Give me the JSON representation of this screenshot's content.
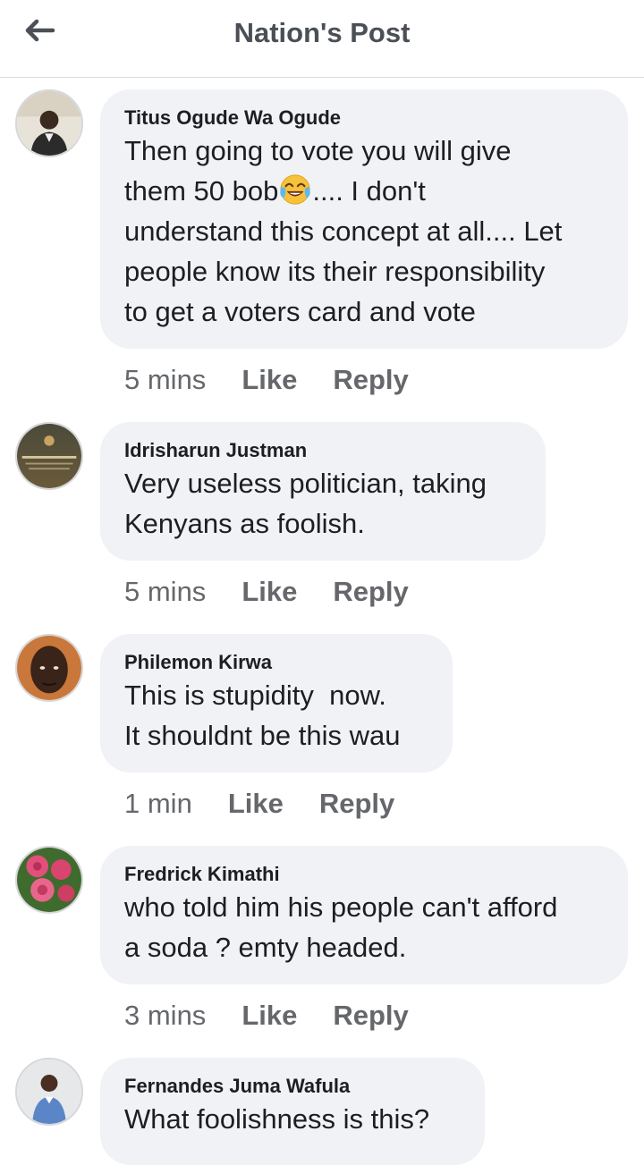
{
  "header": {
    "title": "Nation's Post",
    "back_icon": "arrow-left-icon"
  },
  "comments": [
    {
      "author": "Titus Ogude Wa Ogude",
      "lines": [
        {
          "before": "Then going to vote you will give",
          "emoji": "",
          "after": ""
        },
        {
          "before": "them 50 bob",
          "emoji": "face-with-tears-of-joy",
          "after": ".... I don't"
        },
        {
          "before": "understand this concept at all.... Let",
          "emoji": "",
          "after": ""
        },
        {
          "before": "people know its their responsibility",
          "emoji": "",
          "after": ""
        },
        {
          "before": "to get a voters card and vote",
          "emoji": "",
          "after": ""
        }
      ],
      "time": "5 mins",
      "like": "Like",
      "reply": "Reply"
    },
    {
      "author": "Idrisharun Justman",
      "lines": [
        {
          "before": "Very useless politician, taking",
          "emoji": "",
          "after": ""
        },
        {
          "before": "Kenyans as foolish.",
          "emoji": "",
          "after": ""
        }
      ],
      "time": "5 mins",
      "like": "Like",
      "reply": "Reply"
    },
    {
      "author": "Philemon Kirwa",
      "lines": [
        {
          "before": "This is stupidity  now.",
          "emoji": "",
          "after": ""
        },
        {
          "before": "It shouldnt be this wau",
          "emoji": "",
          "after": ""
        }
      ],
      "time": "1 min",
      "like": "Like",
      "reply": "Reply"
    },
    {
      "author": "Fredrick Kimathi",
      "lines": [
        {
          "before": "who told him his people can't afford",
          "emoji": "",
          "after": ""
        },
        {
          "before": "a soda ? emty headed.",
          "emoji": "",
          "after": ""
        }
      ],
      "time": "3 mins",
      "like": "Like",
      "reply": "Reply"
    },
    {
      "author": "Fernandes Juma Wafula",
      "lines": [
        {
          "before": "What foolishness is this?",
          "emoji": "",
          "after": ""
        }
      ],
      "time": "",
      "like": "",
      "reply": ""
    }
  ],
  "colors": {
    "bubble": "#f0f2f5",
    "meta": "#65676b",
    "title": "#4b4f56"
  }
}
